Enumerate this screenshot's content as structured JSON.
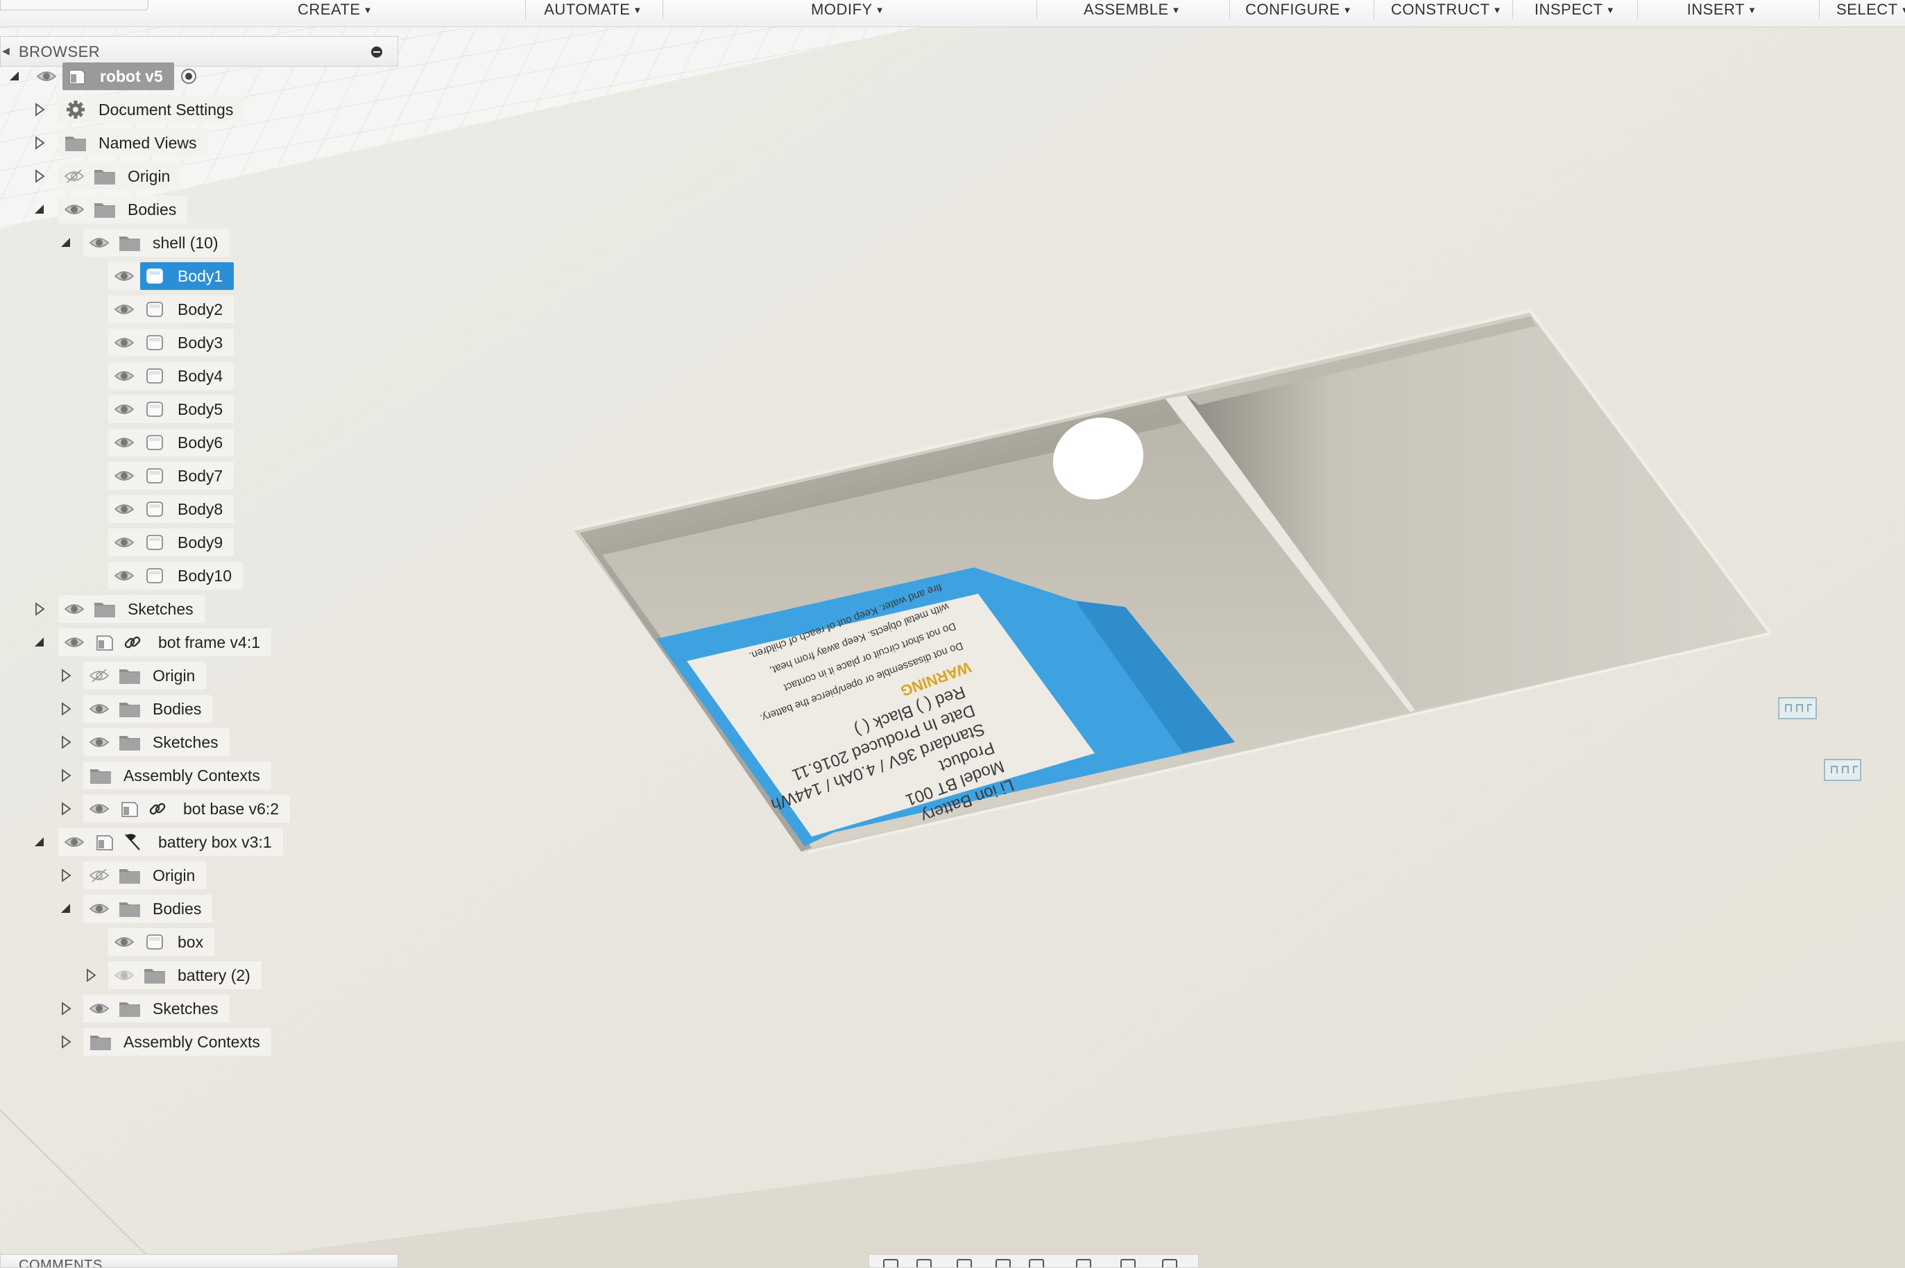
{
  "toolbar": {
    "menus": [
      {
        "label": "CREATE",
        "icon": "caret-down-icon"
      },
      {
        "label": "AUTOMATE",
        "icon": "caret-down-icon"
      },
      {
        "label": "MODIFY",
        "icon": "caret-down-icon"
      },
      {
        "label": "ASSEMBLE",
        "icon": "caret-down-icon"
      },
      {
        "label": "CONFIGURE",
        "icon": "caret-down-icon"
      },
      {
        "label": "CONSTRUCT",
        "icon": "caret-down-icon"
      },
      {
        "label": "INSPECT",
        "icon": "caret-down-icon"
      },
      {
        "label": "INSERT",
        "icon": "caret-down-icon"
      },
      {
        "label": "SELECT",
        "icon": "caret-down-icon"
      }
    ]
  },
  "browser": {
    "title": "BROWSER",
    "tree": [
      {
        "label": "robot v5",
        "level": 0,
        "expanded": true,
        "visible": true,
        "icon": "component-icon",
        "extra": "radio-target-icon",
        "root": true
      },
      {
        "label": "Document Settings",
        "level": 1,
        "expanded": false,
        "icon": "gear-icon"
      },
      {
        "label": "Named Views",
        "level": 1,
        "expanded": false,
        "icon": "folder-icon"
      },
      {
        "label": "Origin",
        "level": 1,
        "expanded": false,
        "visible": false,
        "icon": "folder-icon"
      },
      {
        "label": "Bodies",
        "level": 1,
        "expanded": true,
        "visible": true,
        "icon": "folder-icon"
      },
      {
        "label": "shell (10)",
        "level": 2,
        "expanded": true,
        "visible": true,
        "icon": "folder-icon"
      },
      {
        "label": "Body1",
        "level": 3,
        "visible": true,
        "icon": "body-icon",
        "selected": true
      },
      {
        "label": "Body2",
        "level": 3,
        "visible": true,
        "icon": "body-icon"
      },
      {
        "label": "Body3",
        "level": 3,
        "visible": true,
        "icon": "body-icon"
      },
      {
        "label": "Body4",
        "level": 3,
        "visible": true,
        "icon": "body-icon"
      },
      {
        "label": "Body5",
        "level": 3,
        "visible": true,
        "icon": "body-icon"
      },
      {
        "label": "Body6",
        "level": 3,
        "visible": true,
        "icon": "body-icon"
      },
      {
        "label": "Body7",
        "level": 3,
        "visible": true,
        "icon": "body-icon"
      },
      {
        "label": "Body8",
        "level": 3,
        "visible": true,
        "icon": "body-icon"
      },
      {
        "label": "Body9",
        "level": 3,
        "visible": true,
        "icon": "body-icon"
      },
      {
        "label": "Body10",
        "level": 3,
        "visible": true,
        "icon": "body-icon"
      },
      {
        "label": "Sketches",
        "level": 1,
        "expanded": false,
        "visible": true,
        "icon": "folder-icon"
      },
      {
        "label": "bot frame v4:1",
        "level": 1,
        "expanded": true,
        "visible": true,
        "icon": "component-icon",
        "extra": "link-icon"
      },
      {
        "label": "Origin",
        "level": 2,
        "expanded": false,
        "visible": false,
        "icon": "folder-icon"
      },
      {
        "label": "Bodies",
        "level": 2,
        "expanded": false,
        "visible": true,
        "icon": "folder-icon"
      },
      {
        "label": "Sketches",
        "level": 2,
        "expanded": false,
        "visible": true,
        "icon": "folder-icon"
      },
      {
        "label": "Assembly Contexts",
        "level": 2,
        "expanded": false,
        "icon": "folder-icon"
      },
      {
        "label": "bot base v6:2",
        "level": 2,
        "expanded": false,
        "visible": true,
        "icon": "component-icon",
        "extra": "link-icon"
      },
      {
        "label": "battery box v3:1",
        "level": 1,
        "expanded": true,
        "visible": true,
        "icon": "component-icon",
        "extra": "flag-icon"
      },
      {
        "label": "Origin",
        "level": 2,
        "expanded": false,
        "visible": false,
        "icon": "folder-icon"
      },
      {
        "label": "Bodies",
        "level": 2,
        "expanded": true,
        "visible": true,
        "icon": "folder-icon"
      },
      {
        "label": "box",
        "level": 3,
        "visible": true,
        "icon": "body-icon"
      },
      {
        "label": "battery (2)",
        "level": 3,
        "expanded": false,
        "visible": true,
        "dim": true,
        "icon": "folder-icon"
      },
      {
        "label": "Sketches",
        "level": 2,
        "expanded": false,
        "visible": true,
        "icon": "folder-icon"
      },
      {
        "label": "Assembly Contexts",
        "level": 2,
        "expanded": false,
        "icon": "folder-icon"
      }
    ]
  },
  "battery_label": {
    "lines": [
      "Li ion Battery",
      "Model BT 001",
      "Product",
      "Standard 36V / 4.0Ah / 144Wh",
      "Date In Produced 2016.11",
      "Red ( )  Black ( )",
      "WARNING",
      "Do not disassemble or open/pierce the battery.",
      "Do not short circuit or place it in contact",
      "with metal objects. Keep away from heat,",
      "fire and water. Keep out of reach of children."
    ]
  },
  "comments": {
    "title": "COMMENTS"
  },
  "colors": {
    "accent": "#2a8fd6",
    "battery_blue": "#3ea2e0",
    "canvas": "#e8e5dc"
  },
  "navigation_bar": {
    "icons": [
      "orbit-constrained-icon",
      "look-at-icon",
      "pan-icon",
      "zoom-icon",
      "fit-icon",
      "display-settings-icon",
      "grid-settings-icon",
      "viewports-icon"
    ]
  }
}
